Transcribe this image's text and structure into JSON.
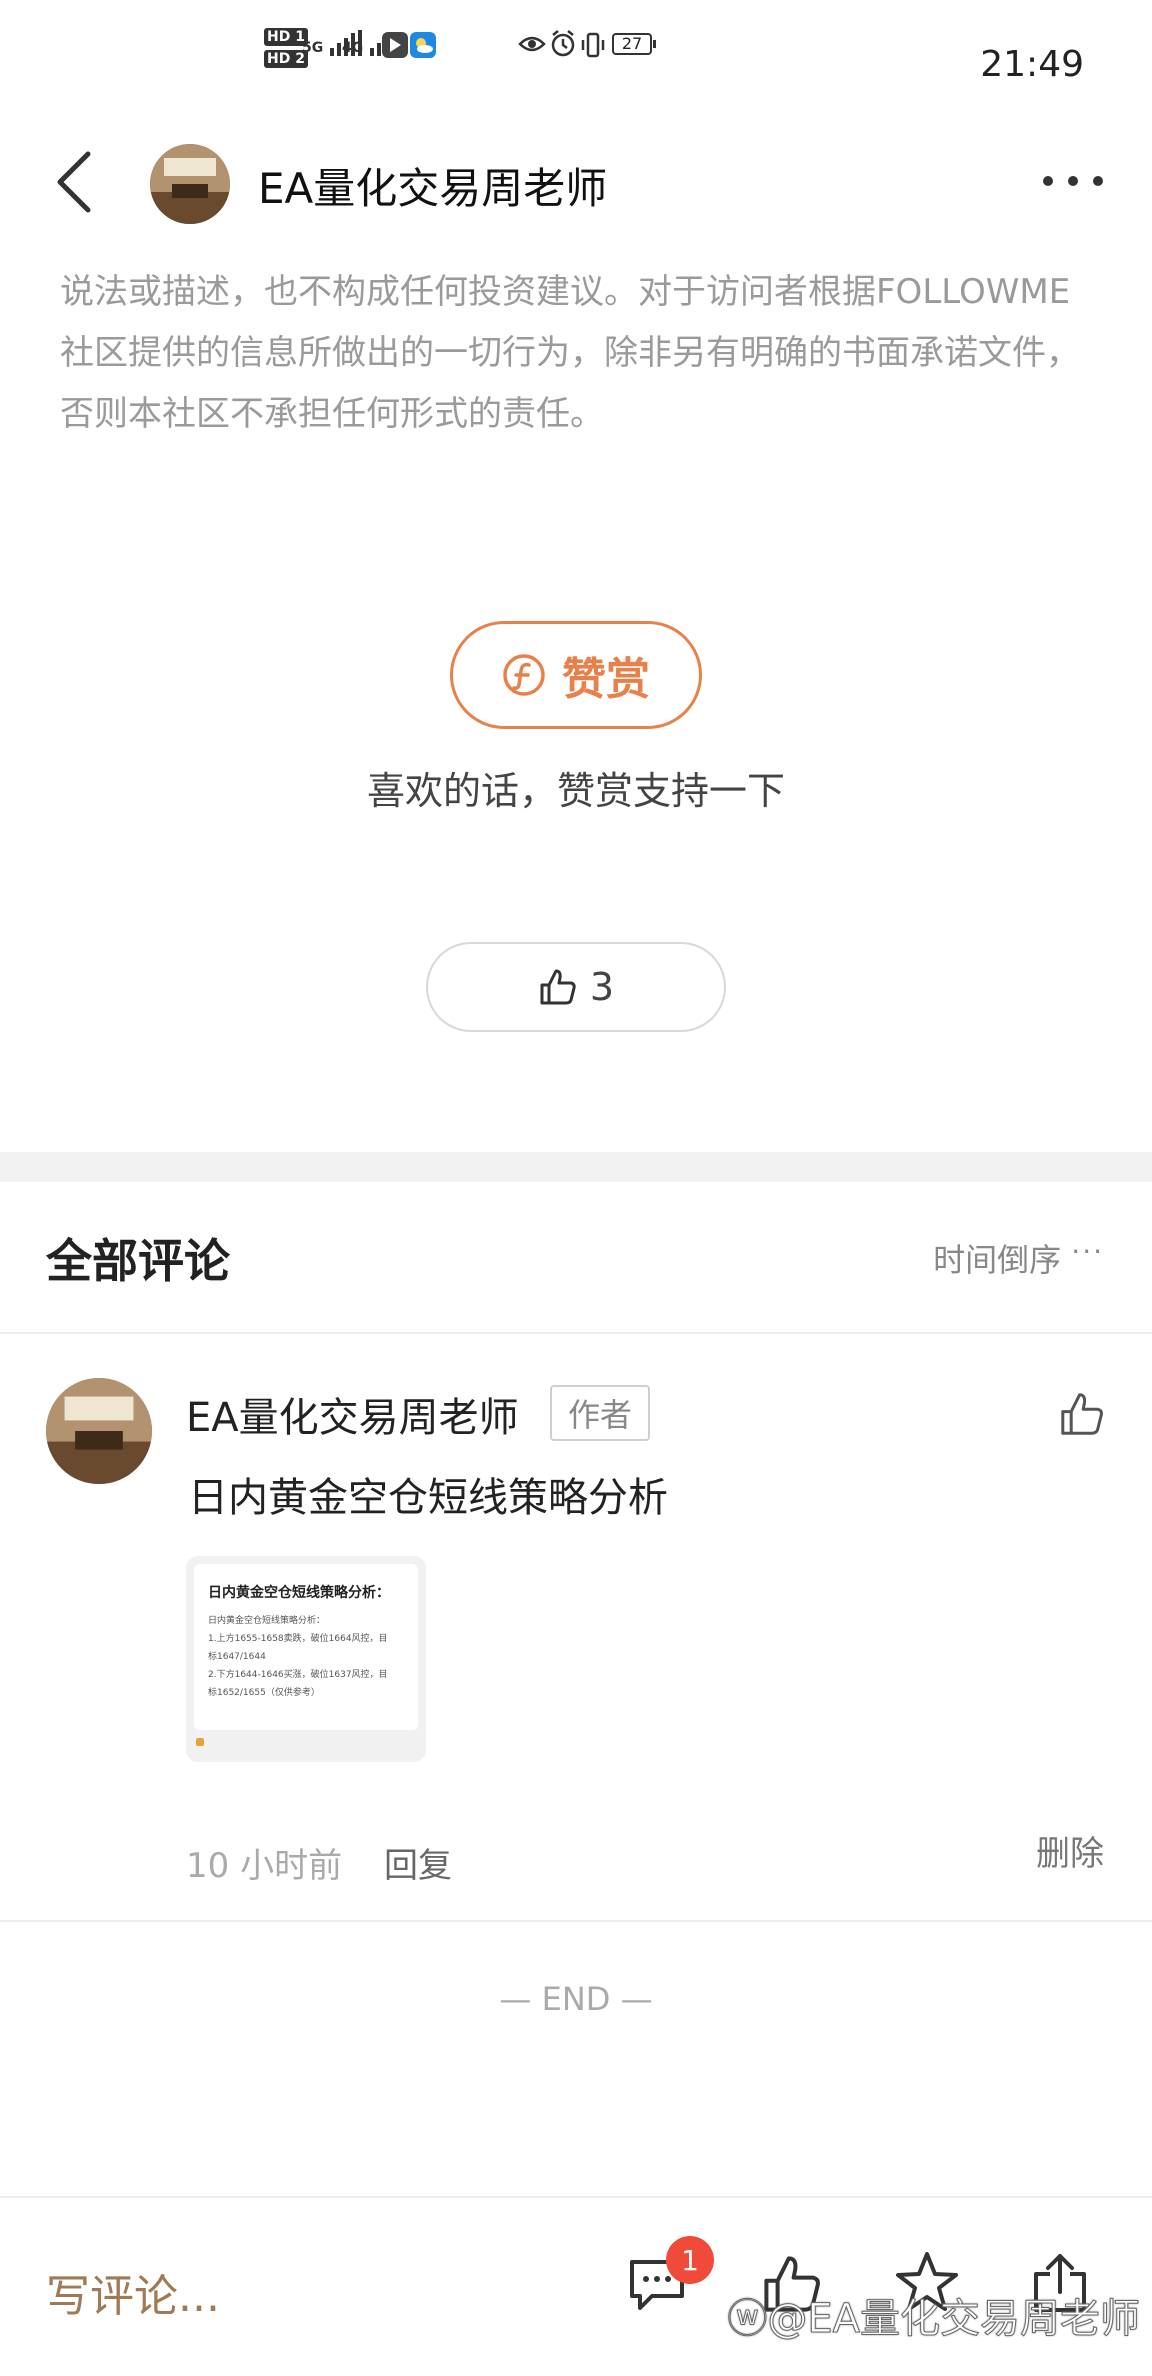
{
  "status_bar": {
    "hd1": "HD 1",
    "hd2": "HD 2",
    "net1": "5G",
    "net2": "4G",
    "battery": "27",
    "time": "21:49"
  },
  "header": {
    "title": "EA量化交易周老师"
  },
  "article": {
    "disclaimer": "说法或描述，也不构成任何投资建议。对于访问者根据FOLLOWME 社区提供的信息所做出的一切行为，除非另有明确的书面承诺文件，否则本社区不承担任何形式的责任。",
    "tip_label": "赞赏",
    "tip_hint": "喜欢的话，赞赏支持一下",
    "like_count": "3"
  },
  "comments": {
    "title": "全部评论",
    "sort": "时间倒序",
    "items": [
      {
        "author": "EA量化交易周老师",
        "badge": "作者",
        "text": "日内黄金空仓短线策略分析",
        "thumbnail": {
          "title": "日内黄金空仓短线策略分析：",
          "lines": [
            "日内黄金空仓短线策略分析：",
            "1.上方1655-1658卖跌，破位1664风控，目",
            "标1647/1644",
            "  2.下方1644-1646买涨，破位1637风控，目",
            "标1652/1655（仅供参考）"
          ]
        },
        "time": "10 小时前",
        "reply": "回复",
        "delete": "删除"
      }
    ],
    "end": "— END —"
  },
  "bottom_bar": {
    "write_placeholder": "写评论...",
    "comment_badge": "1",
    "watermark": "@EA量化交易周老师"
  },
  "colors": {
    "accent": "#e8804a",
    "badge": "#f04a3a",
    "write": "#a07a55"
  }
}
